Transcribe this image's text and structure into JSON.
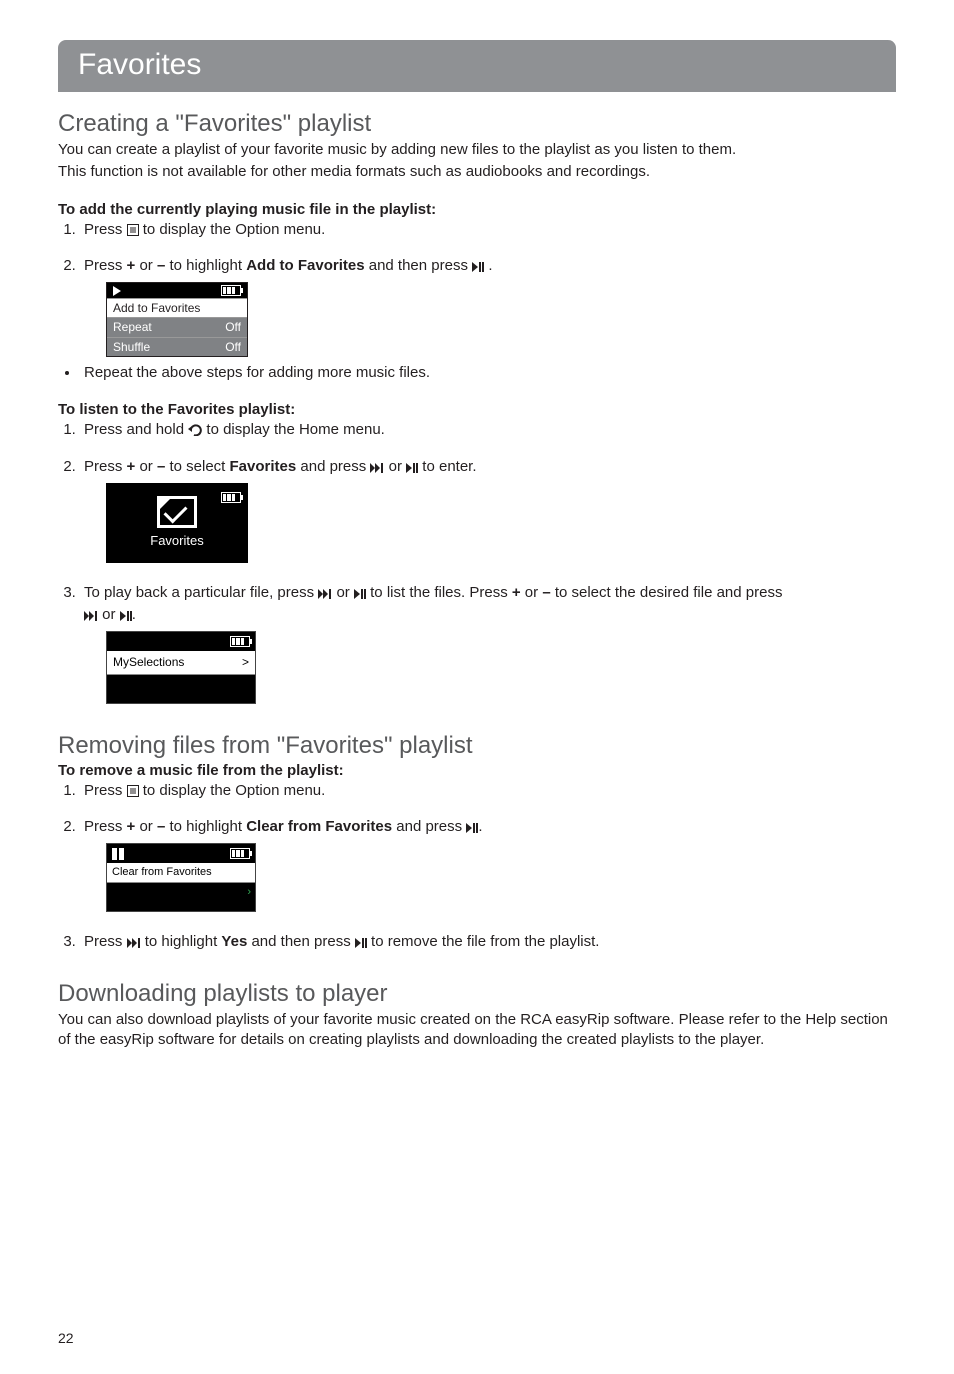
{
  "banner": "Favorites",
  "section_creating": {
    "heading": "Creating a \"Favorites\" playlist",
    "intro1": "You can create a playlist of your favorite music by adding new files to the playlist as you listen to them.",
    "intro2": "This function is not available for other media formats such as audiobooks and recordings.",
    "subhead_add": "To add the currently playing music file in the playlist:",
    "step1_a": "Press ",
    "step1_b": " to display the Option menu.",
    "step2_a": "Press ",
    "plus": "+",
    "or": " or ",
    "minus": "–",
    "step2_b": " to highlight ",
    "step2_bold": "Add to Favorites",
    "step2_c": " and then press ",
    "period": " .",
    "lcd_add": {
      "row1": "Add to Favorites",
      "row2_l": "Repeat",
      "row2_r": "Off",
      "row3_l": "Shuffle",
      "row3_r": "Off"
    },
    "bullet": "Repeat the above steps for adding more music files.",
    "subhead_listen": "To listen to the Favorites playlist:",
    "listen1_a": "Press and hold ",
    "listen1_b": " to display the Home menu.",
    "listen2_a": "Press ",
    "listen2_b": " to select ",
    "listen2_bold": "Favorites",
    "listen2_c": " and press ",
    "listen2_d": " to enter.",
    "fav_label": "Favorites",
    "listen3_a": "To play back a particular file, press ",
    "listen3_b": " to list the files. Press ",
    "listen3_c": " to select the desired file and press",
    "listen3_end": ".",
    "myselections": "MySelections",
    "chevron": ">"
  },
  "section_removing": {
    "heading": "Removing files from \"Favorites\" playlist",
    "subhead": "To remove a music file from the playlist:",
    "step1_a": "Press ",
    "step1_b": " to display the Option menu.",
    "step2_a": "Press ",
    "step2_b": " to highlight ",
    "step2_bold": "Clear from Favorites",
    "step2_c": " and press ",
    "period": ".",
    "lcd_clear_row": "Clear from Favorites",
    "step3_a": "Press ",
    "step3_b": " to highlight ",
    "step3_bold": "Yes",
    "step3_c": " and then press ",
    "step3_d": " to remove the file from the playlist."
  },
  "section_download": {
    "heading": "Downloading playlists to player",
    "body": "You can also download playlists of your favorite music created on the RCA easyRip software. Please refer to the Help section of the easyRip software for details on creating playlists and downloading the created playlists to the player."
  },
  "page_number": "22"
}
